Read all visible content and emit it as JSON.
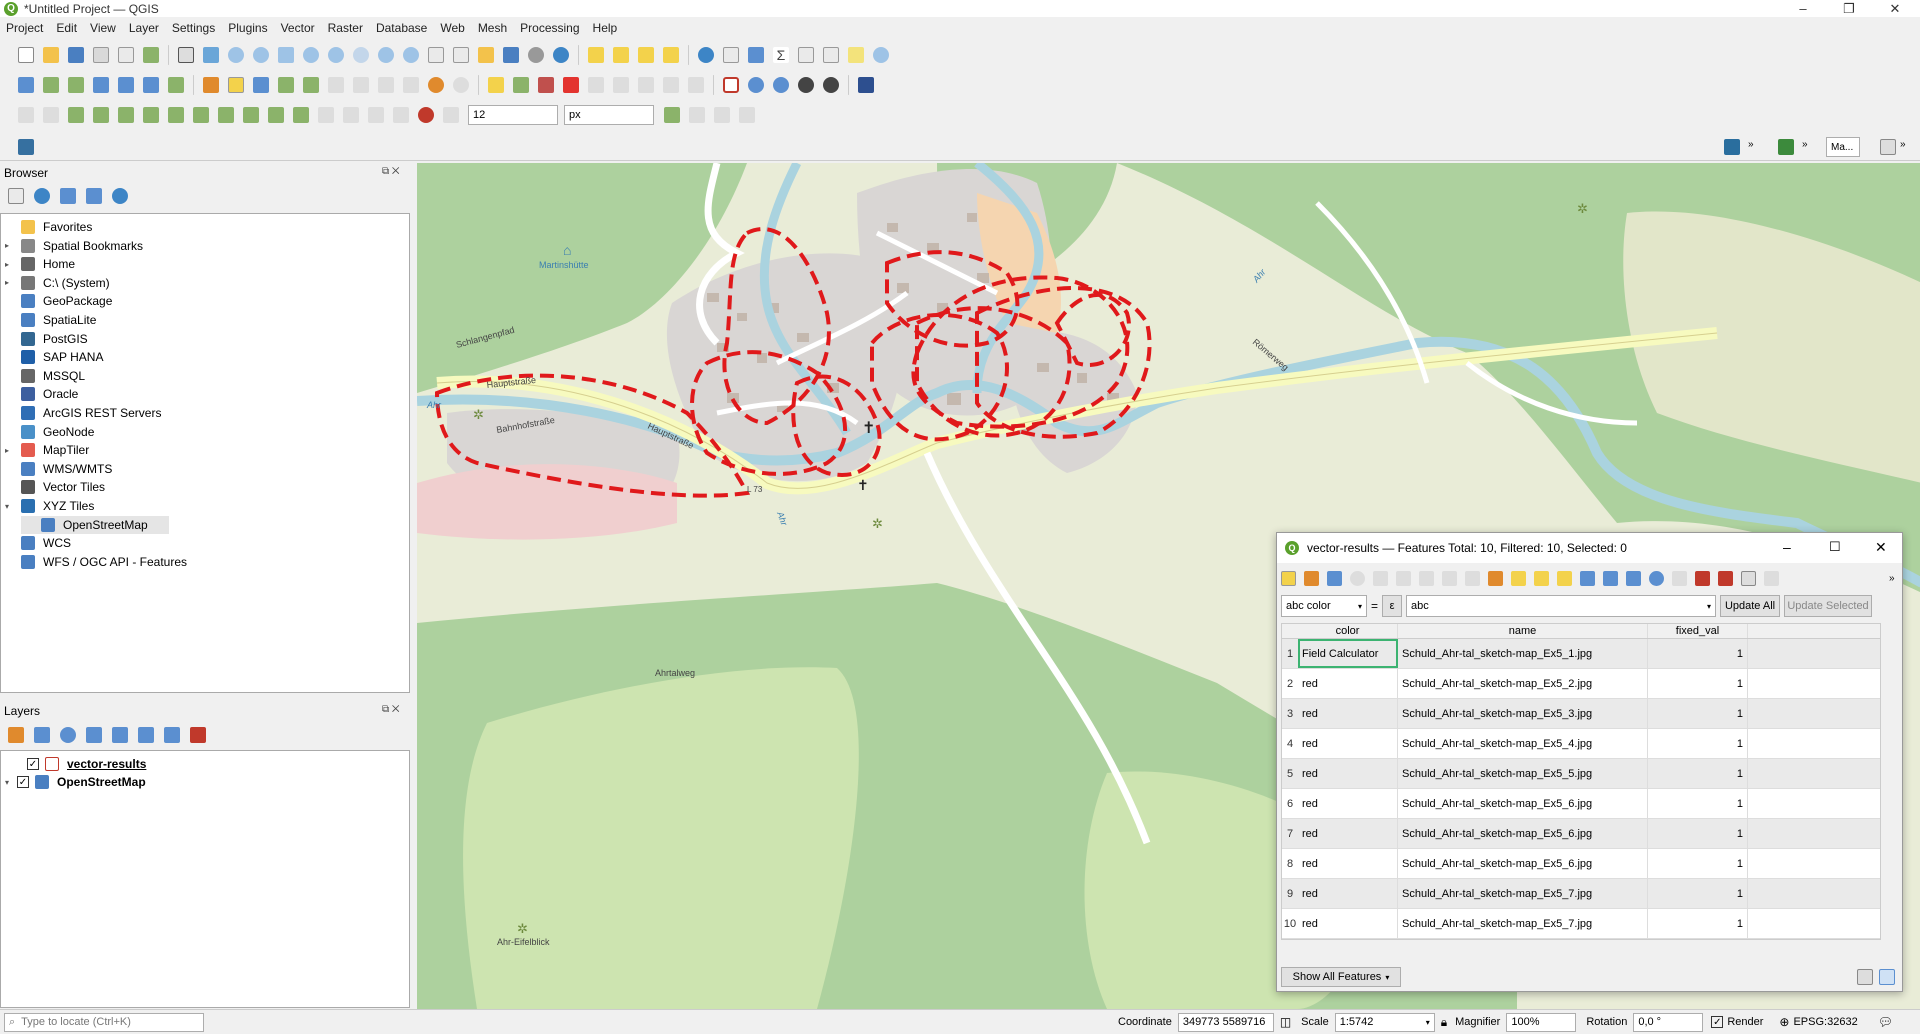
{
  "window": {
    "title": "*Untitled Project — QGIS"
  },
  "menu": [
    "Project",
    "Edit",
    "View",
    "Layer",
    "Settings",
    "Plugins",
    "Vector",
    "Raster",
    "Database",
    "Web",
    "Mesh",
    "Processing",
    "Help"
  ],
  "toolbar": {
    "size_value": "12",
    "unit_value": "px",
    "search_box": "Ma..."
  },
  "browser": {
    "title": "Browser",
    "items": [
      {
        "label": "Favorites",
        "icon": "star-icon",
        "expand": ""
      },
      {
        "label": "Spatial Bookmarks",
        "icon": "bookmark-icon",
        "expand": "▸"
      },
      {
        "label": "Home",
        "icon": "home-folder-icon",
        "expand": "▸"
      },
      {
        "label": "C:\\ (System)",
        "icon": "drive-icon",
        "expand": "▸"
      },
      {
        "label": "GeoPackage",
        "icon": "geopackage-icon",
        "expand": ""
      },
      {
        "label": "SpatiaLite",
        "icon": "spatialite-icon",
        "expand": ""
      },
      {
        "label": "PostGIS",
        "icon": "postgis-icon",
        "expand": ""
      },
      {
        "label": "SAP HANA",
        "icon": "sap-hana-icon",
        "expand": ""
      },
      {
        "label": "MSSQL",
        "icon": "mssql-icon",
        "expand": ""
      },
      {
        "label": "Oracle",
        "icon": "oracle-icon",
        "expand": ""
      },
      {
        "label": "ArcGIS REST Servers",
        "icon": "arcgis-icon",
        "expand": ""
      },
      {
        "label": "GeoNode",
        "icon": "geonode-icon",
        "expand": ""
      },
      {
        "label": "MapTiler",
        "icon": "maptiler-icon",
        "expand": "▸"
      },
      {
        "label": "WMS/WMTS",
        "icon": "wms-icon",
        "expand": ""
      },
      {
        "label": "Vector Tiles",
        "icon": "vector-tiles-icon",
        "expand": ""
      },
      {
        "label": "XYZ Tiles",
        "icon": "xyz-tiles-icon",
        "expand": "▾"
      },
      {
        "label": "OpenStreetMap",
        "icon": "xyz-layer-icon",
        "expand": ""
      },
      {
        "label": "WCS",
        "icon": "wcs-icon",
        "expand": ""
      },
      {
        "label": "WFS / OGC API - Features",
        "icon": "wfs-icon",
        "expand": ""
      }
    ]
  },
  "layers": {
    "title": "Layers",
    "items": [
      {
        "label": "vector-results",
        "checked": true
      },
      {
        "label": "OpenStreetMap",
        "checked": true
      }
    ]
  },
  "map_labels": {
    "hauptstrasse": "Hauptstraße",
    "bahnhofstrasse": "Bahnhofstraße",
    "martinshuette": "Martinshütte",
    "schlangenpfad": "Schlangenpfad",
    "ahr": "Ahr",
    "l73": "L 73",
    "romerweg": "Römerweg",
    "ahrtalweg": "Ahrtalweg",
    "ahr_eifelblick": "Ahr-Eifelblick"
  },
  "attribute_table": {
    "title": "vector-results — Features Total: 10, Filtered: 10, Selected: 0",
    "field_select": "abc color",
    "equals": "=",
    "expr_btn": "ε",
    "expression": "abc",
    "update_all": "Update All",
    "update_selected": "Update Selected",
    "columns": [
      "color",
      "name",
      "fixed_val"
    ],
    "rows": [
      {
        "n": "1",
        "color": "Field Calculator",
        "name": "Schuld_Ahr-tal_sketch-map_Ex5_1.jpg",
        "fixed_val": "1"
      },
      {
        "n": "2",
        "color": "red",
        "name": "Schuld_Ahr-tal_sketch-map_Ex5_2.jpg",
        "fixed_val": "1"
      },
      {
        "n": "3",
        "color": "red",
        "name": "Schuld_Ahr-tal_sketch-map_Ex5_3.jpg",
        "fixed_val": "1"
      },
      {
        "n": "4",
        "color": "red",
        "name": "Schuld_Ahr-tal_sketch-map_Ex5_4.jpg",
        "fixed_val": "1"
      },
      {
        "n": "5",
        "color": "red",
        "name": "Schuld_Ahr-tal_sketch-map_Ex5_5.jpg",
        "fixed_val": "1"
      },
      {
        "n": "6",
        "color": "red",
        "name": "Schuld_Ahr-tal_sketch-map_Ex5_6.jpg",
        "fixed_val": "1"
      },
      {
        "n": "7",
        "color": "red",
        "name": "Schuld_Ahr-tal_sketch-map_Ex5_6.jpg",
        "fixed_val": "1"
      },
      {
        "n": "8",
        "color": "red",
        "name": "Schuld_Ahr-tal_sketch-map_Ex5_6.jpg",
        "fixed_val": "1"
      },
      {
        "n": "9",
        "color": "red",
        "name": "Schuld_Ahr-tal_sketch-map_Ex5_7.jpg",
        "fixed_val": "1"
      },
      {
        "n": "10",
        "color": "red",
        "name": "Schuld_Ahr-tal_sketch-map_Ex5_7.jpg",
        "fixed_val": "1"
      }
    ],
    "show_all": "Show All Features"
  },
  "statusbar": {
    "locate_placeholder": "Type to locate (Ctrl+K)",
    "coordinate_label": "Coordinate",
    "coordinate_value": "349773 5589716",
    "scale_label": "Scale",
    "scale_value": "1:5742",
    "magnifier_label": "Magnifier",
    "magnifier_value": "100%",
    "rotation_label": "Rotation",
    "rotation_value": "0,0 °",
    "render_label": "Render",
    "crs": "EPSG:32632"
  },
  "colors": {
    "accent_red": "#e0191b",
    "qgis_green": "#5aa02c",
    "map_green": "#c9dfae",
    "map_forest": "#add19e",
    "river": "#aad3df"
  }
}
